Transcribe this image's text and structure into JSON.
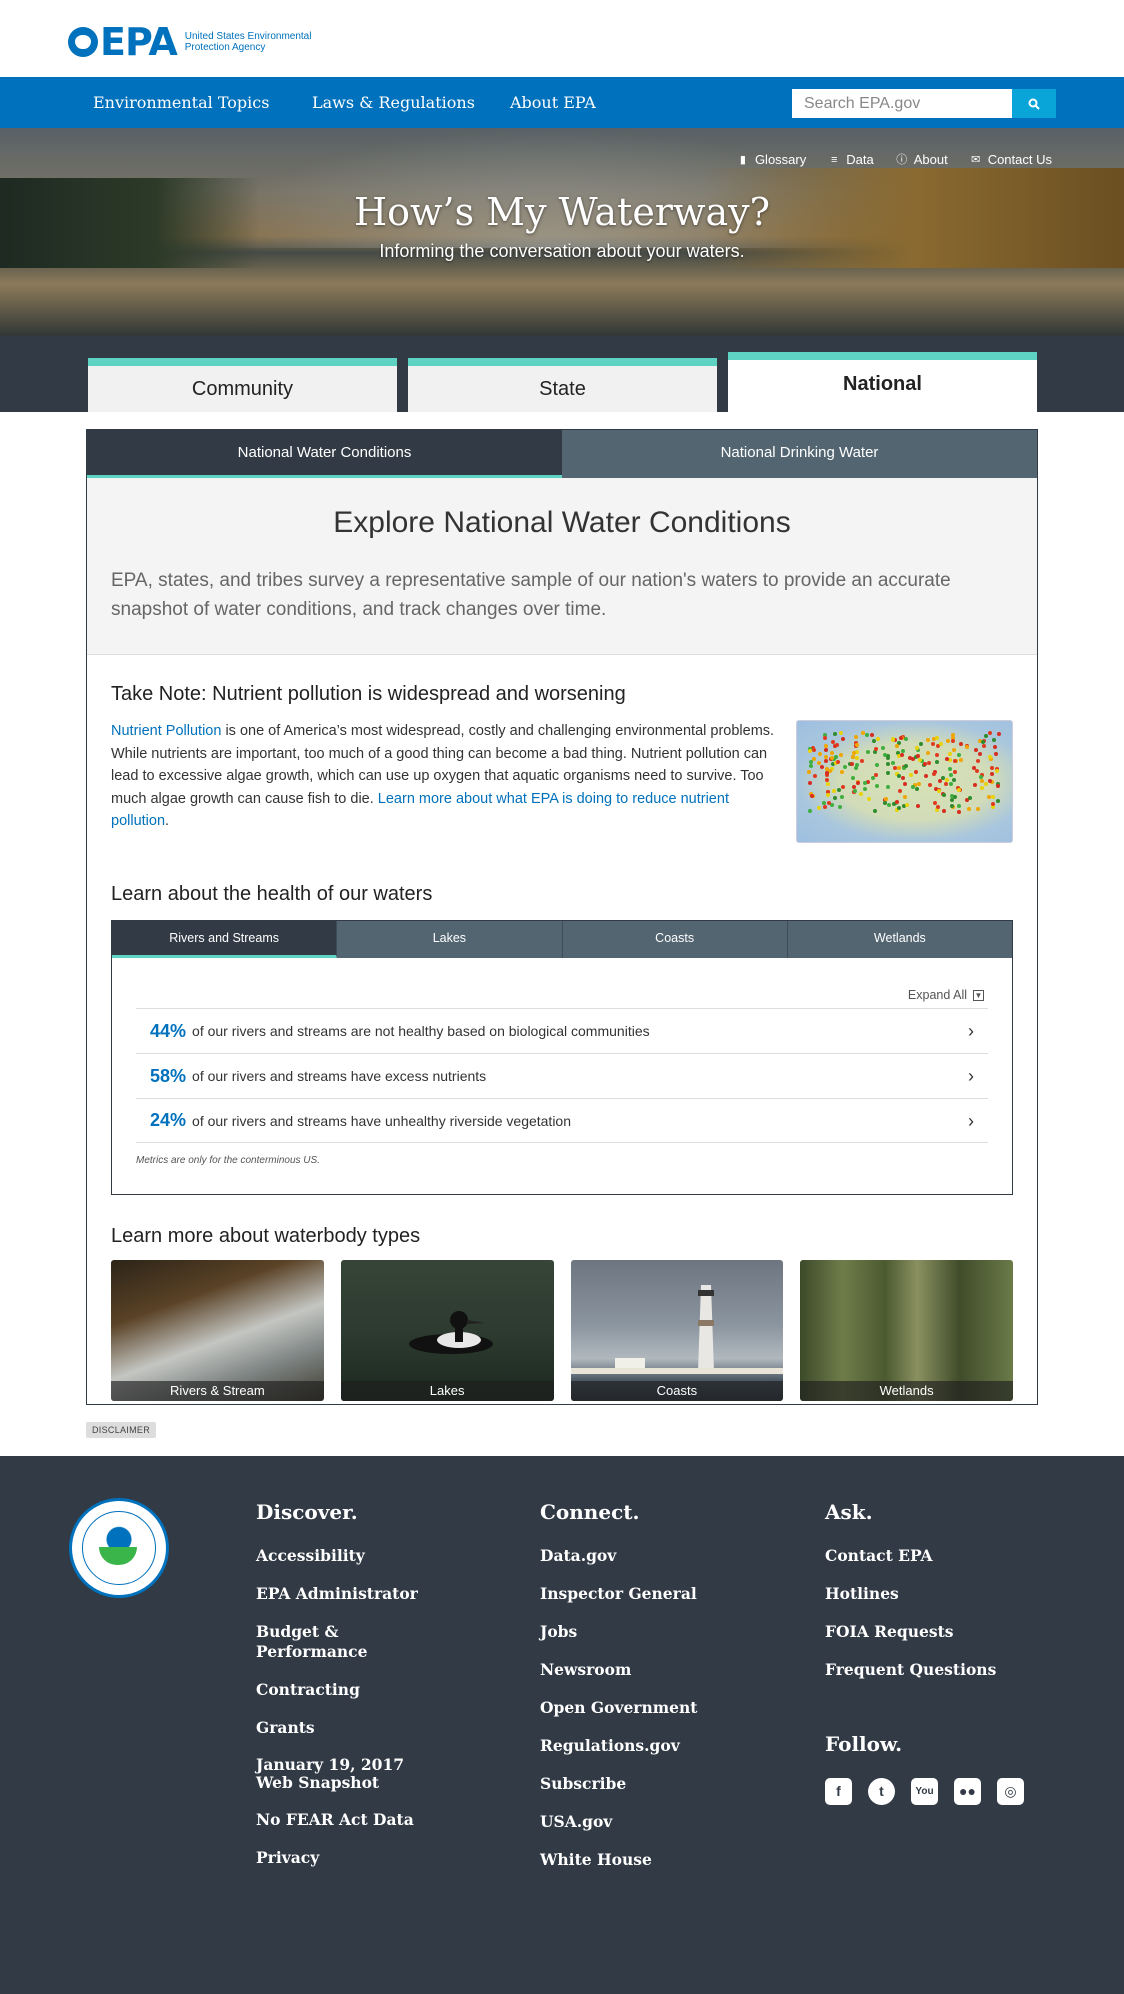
{
  "header": {
    "logo_text": "EPA",
    "agency_name": "United States Environmental Protection Agency"
  },
  "nav": {
    "items": [
      "Environmental Topics",
      "Laws & Regulations",
      "About EPA"
    ],
    "search_placeholder": "Search EPA.gov"
  },
  "hero": {
    "links": [
      {
        "label": "Glossary",
        "icon": "book-icon"
      },
      {
        "label": "Data",
        "icon": "database-icon"
      },
      {
        "label": "About",
        "icon": "info-icon"
      },
      {
        "label": "Contact Us",
        "icon": "envelope-icon"
      }
    ],
    "title": "How’s My Waterway?",
    "subtitle": "Informing the conversation about your waters."
  },
  "main_tabs": [
    "Community",
    "State",
    "National"
  ],
  "main_tabs_active": "National",
  "sub_tabs": [
    "National Water Conditions",
    "National Drinking Water"
  ],
  "intro": {
    "title": "Explore National Water Conditions",
    "text": "EPA, states, and tribes survey a representative sample of our nation's waters to provide an accurate snapshot of water conditions, and track changes over time."
  },
  "note": {
    "title": "Take Note: Nutrient pollution is widespread and worsening",
    "link1": "Nutrient Pollution",
    "text": " is one of America’s most widespread, costly and challenging environmental problems. While nutrients are important, too much of a good thing can become a bad thing. Nutrient pollution can lead to excessive algae growth, which can use up oxygen that aquatic organisms need to survive. Too much algae growth can cause fish to die. ",
    "link2": "Learn more about what EPA is doing to reduce nutrient pollution",
    "end": "."
  },
  "health": {
    "title": "Learn about the health of our waters",
    "tabs": [
      "Rivers and Streams",
      "Lakes",
      "Coasts",
      "Wetlands"
    ],
    "expand_all": "Expand All",
    "metrics": [
      {
        "pct": "44%",
        "text": "of our rivers and streams are not healthy based on biological communities"
      },
      {
        "pct": "58%",
        "text": "of our rivers and streams have excess nutrients"
      },
      {
        "pct": "24%",
        "text": "of our rivers and streams have unhealthy riverside vegetation"
      }
    ],
    "footnote": "Metrics are only for the conterminous US."
  },
  "types": {
    "title": "Learn more about waterbody types",
    "cards": [
      "Rivers & Stream",
      "Lakes",
      "Coasts",
      "Wetlands"
    ]
  },
  "disclaimer": "DISCLAIMER",
  "footer": {
    "discover": {
      "title": "Discover.",
      "links": [
        "Accessibility",
        "EPA Administrator",
        "Budget & Performance",
        "Contracting",
        "Grants",
        "January 19, 2017 Web Snapshot",
        "No FEAR Act Data",
        "Privacy"
      ]
    },
    "connect": {
      "title": "Connect.",
      "links": [
        "Data.gov",
        "Inspector General",
        "Jobs",
        "Newsroom",
        "Open Government",
        "Regulations.gov",
        "Subscribe",
        "USA.gov",
        "White House"
      ]
    },
    "ask": {
      "title": "Ask.",
      "links": [
        "Contact EPA",
        "Hotlines",
        "FOIA Requests",
        "Frequent Questions"
      ]
    },
    "follow": {
      "title": "Follow.",
      "icons": [
        "facebook-icon",
        "twitter-icon",
        "youtube-icon",
        "flickr-icon",
        "instagram-icon"
      ]
    }
  }
}
